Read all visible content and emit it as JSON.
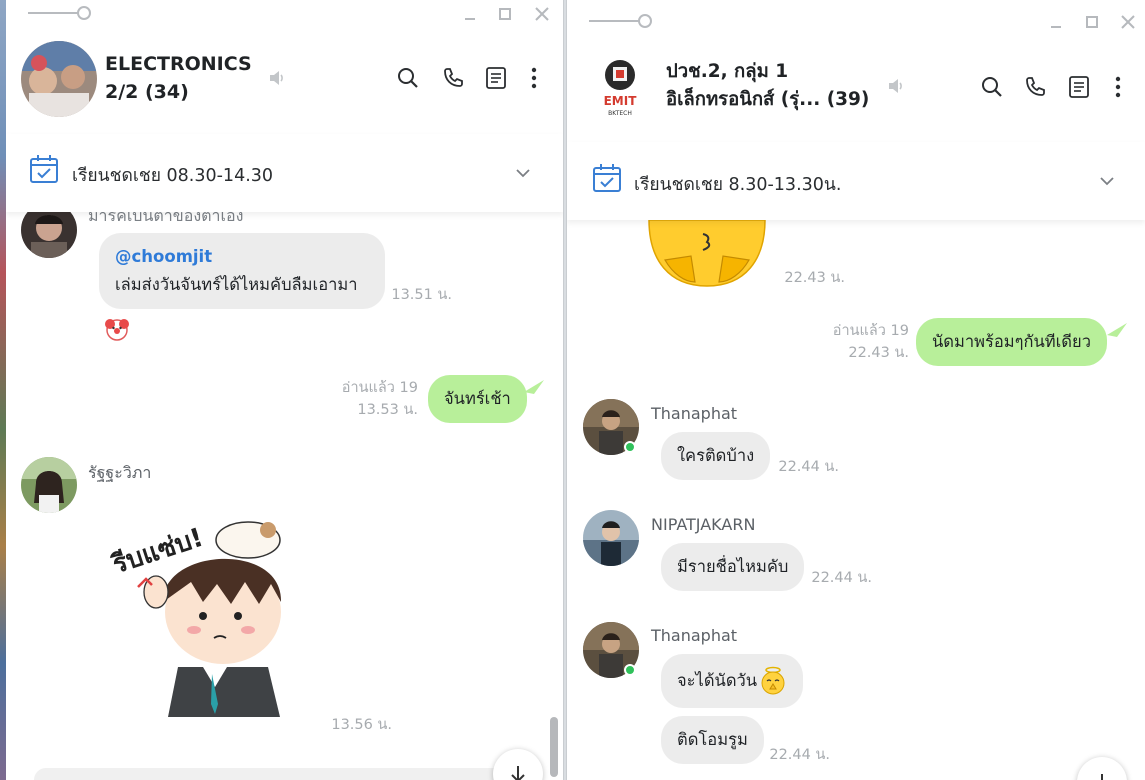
{
  "left": {
    "title_line1": "ELECTRONICS",
    "title_line2": "2/2 (34)",
    "announcement": "เรียนชดเชย 08.30-14.30",
    "partial_sender": "มารคเบนตาของตาเอง",
    "messages": {
      "m1_mention": "@choomjit",
      "m1_text": "เล่มส่งวันจันทร์ได้ไหมคับลืมเอามา",
      "m1_time": "13.51 น.",
      "m2_read": "อ่านแล้ว 19",
      "m2_time": "13.53 น.",
      "m2_text": "จันทร์เช้า",
      "m3_sender": "รัฐฐะวิภา",
      "m3_time": "13.56 น.",
      "sticker_text": "รีบแซ่บ!"
    }
  },
  "right": {
    "title_line1": "ปวช.2, กลุ่ม 1",
    "title_line2": "อิเล็กทรอนิกส์ (รุ่... (39)",
    "logo_text": "EMIT",
    "logo_sub": "BKTECH",
    "announcement": "เรียนชดเชย 8.30-13.30น.",
    "messages": {
      "sticker_time": "22.43 น.",
      "out_read": "อ่านแล้ว 19",
      "out_time": "22.43 น.",
      "out_text": "นัดมาพร้อมๆกันทีเดียว",
      "s1_name": "Thanaphat",
      "s1_text": "ใครติดบ้าง",
      "s1_time": "22.44 น.",
      "s2_name": "NIPATJAKARN",
      "s2_text": "มีรายชื่อไหมคับ",
      "s2_time": "22.44 น.",
      "s3_name": "Thanaphat",
      "s3_text1": "จะได้นัดวัน",
      "s3_text2": "ติดโอมรูม",
      "s3_time": "22.44 น."
    }
  },
  "colors": {
    "bubble_out": "#b8ef9a",
    "bubble_in": "#ececec",
    "accent_blue": "#2f7bd8"
  }
}
